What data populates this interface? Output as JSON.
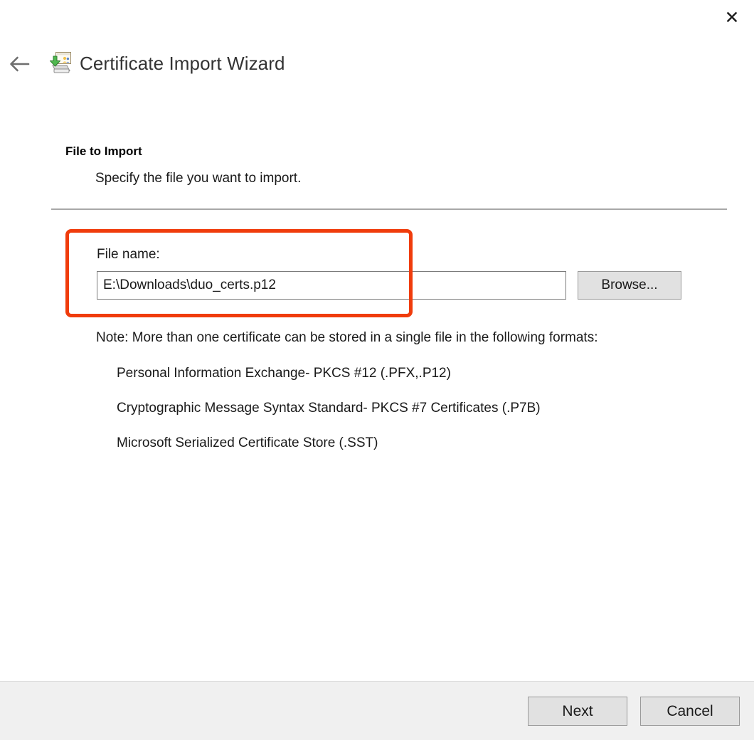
{
  "window": {
    "title": "Certificate Import Wizard",
    "icon": "certificate-import-icon",
    "close_label": "✕",
    "back_label": "back-arrow"
  },
  "page": {
    "heading": "File to Import",
    "subheading": "Specify the file you want to import."
  },
  "file_group": {
    "label": "File name:",
    "value": "E:\\Downloads\\duo_certs.p12",
    "placeholder": "",
    "browse_label": "Browse...",
    "highlight_color": "#f03c0c"
  },
  "notes": {
    "intro": "Note:  More than one certificate can be stored in a single file in the following formats:",
    "formats": [
      "Personal Information Exchange- PKCS #12 (.PFX,.P12)",
      "Cryptographic Message Syntax Standard- PKCS #7 Certificates (.P7B)",
      "Microsoft Serialized Certificate Store (.SST)"
    ]
  },
  "footer": {
    "next_label": "Next",
    "cancel_label": "Cancel"
  }
}
